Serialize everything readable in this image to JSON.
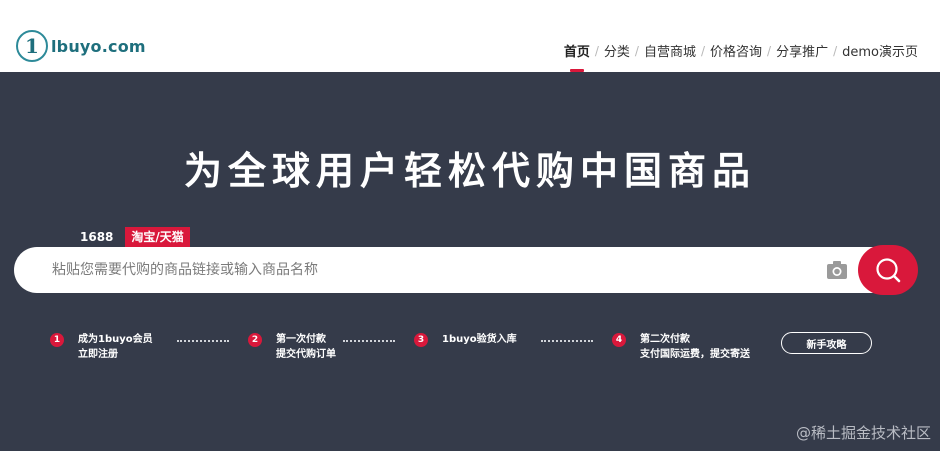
{
  "header": {
    "logo_mark": "1",
    "logo_text": "lbuyo.com",
    "nav": [
      {
        "label": "首页",
        "active": true
      },
      {
        "label": "分类"
      },
      {
        "label": "自营商城"
      },
      {
        "label": "价格咨询"
      },
      {
        "label": "分享推广"
      },
      {
        "label": "demo演示页"
      }
    ],
    "separator": "/"
  },
  "hero": {
    "title": "为全球用户轻松代购中国商品",
    "tabs": {
      "t1688": "1688",
      "taobao": "淘宝/天猫"
    },
    "search": {
      "placeholder": "粘贴您需要代购的商品链接或输入商品名称"
    },
    "steps": [
      {
        "num": "1",
        "line1": "成为1buyo会员",
        "line2": "立即注册"
      },
      {
        "num": "2",
        "line1": "第一次付款",
        "line2": "提交代购订单"
      },
      {
        "num": "3",
        "line1": "1buyo验货入库",
        "line2": ""
      },
      {
        "num": "4",
        "line1": "第二次付款",
        "line2": "支付国际运费，提交寄送"
      }
    ],
    "guide_button": "新手攻略"
  },
  "watermark": "@稀土掘金技术社区",
  "colors": {
    "accent": "#d9183b",
    "hero_bg": "#353b4a",
    "brand": "#1e6f7d"
  }
}
